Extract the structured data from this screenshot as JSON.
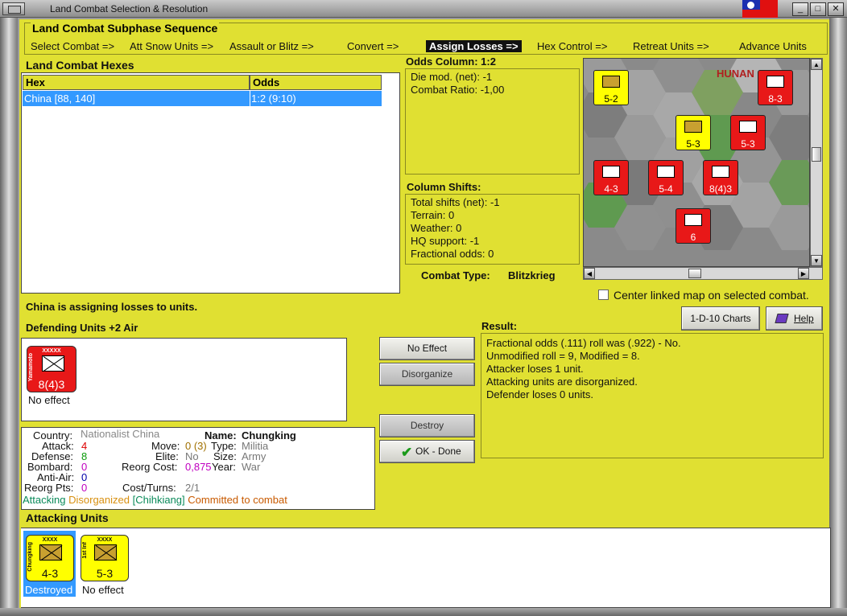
{
  "window": {
    "title": "Land Combat Selection & Resolution",
    "close": "✕",
    "minimize": "_",
    "maximize": "□"
  },
  "sequence": {
    "title": "Land Combat Subphase Sequence",
    "steps": [
      "Select Combat =>",
      "Att Snow Units =>",
      "Assault or Blitz =>",
      "Convert =>",
      "Assign Losses =>",
      "Hex Control =>",
      "Retreat Units =>",
      "Advance Units"
    ],
    "active": "Assign Losses =>"
  },
  "hexes": {
    "title": "Land Combat Hexes",
    "col_hex": "Hex",
    "col_odds": "Odds",
    "rows": [
      {
        "hex": "China [88, 140]",
        "odds": "1:2 (9:10)"
      }
    ]
  },
  "odds": {
    "title": "Odds Column: 1:2",
    "lines": [
      "Die mod. (net): -1",
      "Combat Ratio: -1,00"
    ]
  },
  "shifts": {
    "title": "Column Shifts:",
    "lines": [
      "Total shifts (net): -1",
      "Terrain: 0",
      "Weather: 0",
      "HQ support: -1",
      "Fractional odds: 0"
    ]
  },
  "combat_type": {
    "label": "Combat Type:",
    "value": "Blitzkrieg"
  },
  "map": {
    "label": "HUNAN",
    "center_label": "Center linked map on selected combat.",
    "counters": [
      {
        "color": "yellow",
        "value": "5-2"
      },
      {
        "color": "red",
        "value": "8-3"
      },
      {
        "color": "yellow",
        "value": "5-3"
      },
      {
        "color": "red",
        "value": "5-3"
      },
      {
        "color": "red",
        "value": "4-3"
      },
      {
        "color": "red",
        "value": "5-4"
      },
      {
        "color": "red",
        "value": "8(4)3"
      },
      {
        "color": "red",
        "value": "6"
      }
    ]
  },
  "status": "China is assigning losses to units.",
  "buttons": {
    "charts": "1-D-10 Charts",
    "help": "Help",
    "no_effect": "No Effect",
    "disorganize": "Disorganize",
    "destroy": "Destroy",
    "ok": "OK - Done"
  },
  "defending": {
    "title": "Defending Units +2 Air",
    "units": [
      {
        "name": "Yamamoto",
        "str": "8(4)3",
        "status": "No effect",
        "color": "red",
        "size": "XXXXX"
      }
    ]
  },
  "result": {
    "title": "Result:",
    "lines": [
      "Fractional odds (.111) roll was (.922)  - No.",
      "Unmodified roll = 9, Modified = 8.",
      "Attacker loses 1 unit.",
      "Attacking units are disorganized.",
      "Defender loses 0 units."
    ]
  },
  "details": {
    "country_label": "Country:",
    "country": "Nationalist China",
    "name_label": "Name:",
    "name": "Chungking",
    "attack_label": "Attack:",
    "attack": "4",
    "move_label": "Move:",
    "move": "0 (3)",
    "type_label": "Type:",
    "type": "Militia",
    "defense_label": "Defense:",
    "defense": "8",
    "elite_label": "Elite:",
    "elite": "No",
    "size_label": "Size:",
    "size": "Army",
    "bombard_label": "Bombard:",
    "bombard": "0",
    "reorg_label": "Reorg Cost:",
    "reorg": "0,875",
    "year_label": "Year:",
    "year": "War",
    "antiair_label": "Anti-Air:",
    "antiair": "0",
    "reorgpts_label": "Reorg Pts:",
    "reorgpts": "0",
    "cost_label": "Cost/Turns:",
    "cost": "2/1",
    "flags": [
      "Attacking",
      "Disorganized",
      "[Chihkiang]",
      "Committed to combat"
    ]
  },
  "attacking": {
    "title": "Attacking Units",
    "units": [
      {
        "name": "Chungking",
        "str": "4-3",
        "status": "Destroyed",
        "color": "yellow",
        "size": "XXXX"
      },
      {
        "name": "1st Inf",
        "str": "5-3",
        "status": "No effect",
        "color": "yellow",
        "size": "XXXX"
      }
    ]
  },
  "colors": {
    "panel": "#e0e032",
    "active_step": "#111111",
    "red_unit": "#e81818",
    "yellow_unit": "#ffff00",
    "selected_row": "#3399ff"
  }
}
